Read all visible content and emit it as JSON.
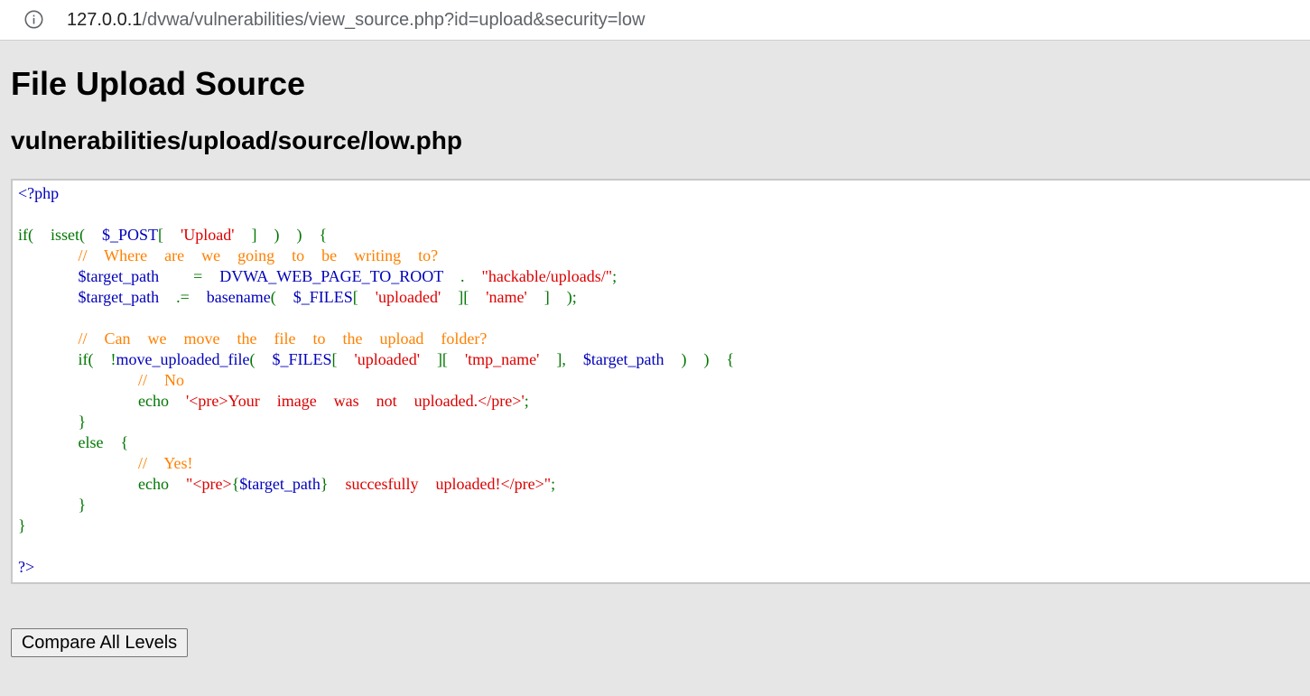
{
  "browser": {
    "info_icon": "info-circle-icon",
    "url_host": "127.0.0.1",
    "url_path": "/dvwa/vulnerabilities/view_source.php?id=upload&security=low"
  },
  "page": {
    "title": "File Upload Source",
    "subtitle": "vulnerabilities/upload/source/low.php",
    "compare_button": "Compare All Levels"
  },
  "colors": {
    "keyword": "#007700",
    "default": "#0000bb",
    "string": "#dd0000",
    "comment": "#ff8000",
    "background": "#e6e6e6"
  },
  "code": {
    "lines": [
      [
        [
          "def",
          "<?php"
        ]
      ],
      [],
      [
        [
          "kw",
          "if(  isset(  "
        ],
        [
          "def",
          "$_POST"
        ],
        [
          "kw",
          "[  "
        ],
        [
          "str",
          "'Upload'"
        ],
        [
          "kw",
          "  ]  )  )  {"
        ]
      ],
      [
        [
          "kw",
          "       "
        ],
        [
          "com",
          "//  Where  are  we  going  to  be  writing  to?"
        ]
      ],
      [
        [
          "kw",
          "       "
        ],
        [
          "def",
          "$target_path"
        ],
        [
          "kw",
          "    =  "
        ],
        [
          "def",
          "DVWA_WEB_PAGE_TO_ROOT"
        ],
        [
          "kw",
          "  .  "
        ],
        [
          "str",
          "\"hackable/uploads/\""
        ],
        [
          "kw",
          ";"
        ]
      ],
      [
        [
          "kw",
          "       "
        ],
        [
          "def",
          "$target_path"
        ],
        [
          "kw",
          "  .=  "
        ],
        [
          "def",
          "basename"
        ],
        [
          "kw",
          "(  "
        ],
        [
          "def",
          "$_FILES"
        ],
        [
          "kw",
          "[  "
        ],
        [
          "str",
          "'uploaded'"
        ],
        [
          "kw",
          "  ][  "
        ],
        [
          "str",
          "'name'"
        ],
        [
          "kw",
          "  ]  );"
        ]
      ],
      [],
      [
        [
          "kw",
          "       "
        ],
        [
          "com",
          "//  Can  we  move  the  file  to  the  upload  folder?"
        ]
      ],
      [
        [
          "kw",
          "       if(  !"
        ],
        [
          "def",
          "move_uploaded_file"
        ],
        [
          "kw",
          "(  "
        ],
        [
          "def",
          "$_FILES"
        ],
        [
          "kw",
          "[  "
        ],
        [
          "str",
          "'uploaded'"
        ],
        [
          "kw",
          "  ][  "
        ],
        [
          "str",
          "'tmp_name'"
        ],
        [
          "kw",
          "  ],  "
        ],
        [
          "def",
          "$target_path"
        ],
        [
          "kw",
          "  )  )  {"
        ]
      ],
      [
        [
          "kw",
          "              "
        ],
        [
          "com",
          "//  No"
        ]
      ],
      [
        [
          "kw",
          "              echo  "
        ],
        [
          "str",
          "'<pre>Your  image  was  not  uploaded.</pre>'"
        ],
        [
          "kw",
          ";"
        ]
      ],
      [
        [
          "kw",
          "       }"
        ]
      ],
      [
        [
          "kw",
          "       else  {"
        ]
      ],
      [
        [
          "kw",
          "              "
        ],
        [
          "com",
          "//  Yes!"
        ]
      ],
      [
        [
          "kw",
          "              echo  "
        ],
        [
          "str",
          "\"<pre>"
        ],
        [
          "kw",
          "{"
        ],
        [
          "def",
          "$target_path"
        ],
        [
          "kw",
          "}"
        ],
        [
          "str",
          "  succesfully  uploaded!</pre>\""
        ],
        [
          "kw",
          ";"
        ]
      ],
      [
        [
          "kw",
          "       }"
        ]
      ],
      [
        [
          "kw",
          "}"
        ]
      ],
      [],
      [
        [
          "def",
          "?>"
        ]
      ]
    ]
  }
}
